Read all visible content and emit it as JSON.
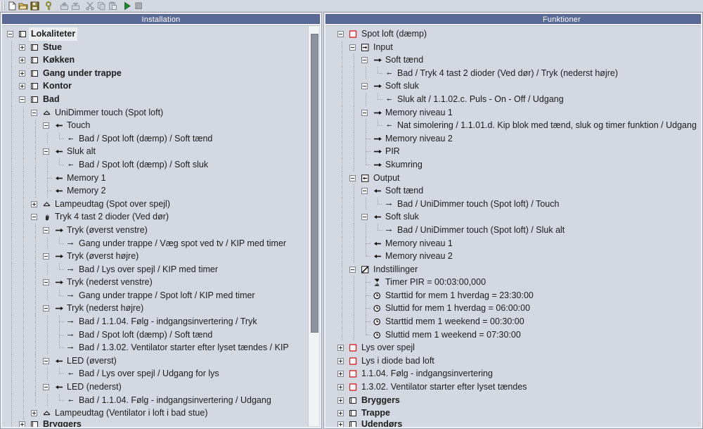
{
  "window": {
    "background_color": "#d4d8e0",
    "title_bar_color": "#5a6a96"
  },
  "toolbar": {
    "items": [
      {
        "name": "new-file-icon",
        "label": "Ny"
      },
      {
        "name": "open-folder-icon",
        "label": "Åbn"
      },
      {
        "name": "save-disk-icon",
        "label": "Gem"
      },
      {
        "name": "key-icon",
        "label": "Nøgle"
      },
      {
        "name": "upload-icon",
        "label": "Send til controller"
      },
      {
        "name": "download-icon",
        "label": "Hent fra controller"
      },
      {
        "name": "cut-scissors-icon",
        "label": "Klip"
      },
      {
        "name": "copy-icon",
        "label": "Kopier"
      },
      {
        "name": "paste-icon",
        "label": "Indsæt"
      },
      {
        "name": "run-play-icon",
        "label": "Start"
      },
      {
        "name": "stop-icon",
        "label": "Stop"
      }
    ]
  },
  "panels": {
    "left": {
      "title": "Installation",
      "scrollbar": {
        "visible": true,
        "thumb_top_pct": 2,
        "thumb_height_pct": 74
      }
    },
    "right": {
      "title": "Funktioner",
      "scrollbar": {
        "visible": false
      }
    }
  },
  "left_tree": [
    {
      "depth": 0,
      "exp": "minus",
      "icon": "folder-square",
      "label": "Lokaliteter",
      "bold": true,
      "selected": true
    },
    {
      "depth": 1,
      "exp": "plus",
      "icon": "folder-square",
      "label": "Stue",
      "bold": true
    },
    {
      "depth": 1,
      "exp": "plus",
      "icon": "folder-square",
      "label": "Køkken",
      "bold": true
    },
    {
      "depth": 1,
      "exp": "plus",
      "icon": "folder-square",
      "label": "Gang under trappe",
      "bold": true
    },
    {
      "depth": 1,
      "exp": "plus",
      "icon": "folder-square",
      "label": "Kontor",
      "bold": true
    },
    {
      "depth": 1,
      "exp": "minus",
      "icon": "folder-square",
      "label": "Bad",
      "bold": true
    },
    {
      "depth": 2,
      "exp": "minus",
      "icon": "lamp-outlet",
      "label": "UniDimmer touch (Spot loft)"
    },
    {
      "depth": 3,
      "exp": "minus",
      "icon": "arrow-left",
      "label": "Touch"
    },
    {
      "depth": 4,
      "exp": "leaf",
      "icon": "link-left",
      "label": "Bad / Spot loft (dæmp) / Soft tænd"
    },
    {
      "depth": 3,
      "exp": "minus",
      "icon": "arrow-left",
      "label": "Sluk alt"
    },
    {
      "depth": 4,
      "exp": "leaf",
      "icon": "link-left",
      "label": "Bad / Spot loft (dæmp) / Soft sluk"
    },
    {
      "depth": 3,
      "exp": "none",
      "icon": "arrow-left",
      "label": "Memory 1"
    },
    {
      "depth": 3,
      "exp": "none",
      "icon": "arrow-left",
      "label": "Memory 2"
    },
    {
      "depth": 2,
      "exp": "plus",
      "icon": "lamp-outlet",
      "label": "Lampeudtag (Spot over spejl)"
    },
    {
      "depth": 2,
      "exp": "minus",
      "icon": "hand-switch",
      "label": "Tryk 4 tast 2 dioder (Ved dør)"
    },
    {
      "depth": 3,
      "exp": "minus",
      "icon": "arrow-right",
      "label": "Tryk (øverst venstre)"
    },
    {
      "depth": 4,
      "exp": "leaf",
      "icon": "link-right",
      "label": "Gang under trappe / Væg spot ved tv / KIP med timer"
    },
    {
      "depth": 3,
      "exp": "minus",
      "icon": "arrow-right",
      "label": "Tryk (øverst højre)"
    },
    {
      "depth": 4,
      "exp": "leaf",
      "icon": "link-right",
      "label": "Bad / Lys over spejl / KIP med timer"
    },
    {
      "depth": 3,
      "exp": "minus",
      "icon": "arrow-right",
      "label": "Tryk (nederst venstre)"
    },
    {
      "depth": 4,
      "exp": "leaf",
      "icon": "link-right",
      "label": "Gang under trappe / Spot loft / KIP med timer"
    },
    {
      "depth": 3,
      "exp": "minus",
      "icon": "arrow-right",
      "label": "Tryk (nederst højre)"
    },
    {
      "depth": 4,
      "exp": "leaf-mid",
      "icon": "link-right",
      "label": "Bad / 1.1.04. Følg - indgangsinvertering / Tryk"
    },
    {
      "depth": 4,
      "exp": "leaf-mid",
      "icon": "link-right",
      "label": "Bad / Spot loft (dæmp) / Soft tænd"
    },
    {
      "depth": 4,
      "exp": "leaf",
      "icon": "link-right",
      "label": "Bad / 1.3.02. Ventilator starter efter lyset tændes / KIP"
    },
    {
      "depth": 3,
      "exp": "minus",
      "icon": "arrow-left",
      "label": "LED (øverst)"
    },
    {
      "depth": 4,
      "exp": "leaf",
      "icon": "link-left",
      "label": "Bad / Lys over spejl / Udgang for lys"
    },
    {
      "depth": 3,
      "exp": "minus",
      "icon": "arrow-left",
      "label": "LED (nederst)"
    },
    {
      "depth": 4,
      "exp": "leaf",
      "icon": "link-left",
      "label": "Bad / 1.1.04. Følg - indgangsinvertering / Udgang"
    },
    {
      "depth": 2,
      "exp": "plus",
      "icon": "lamp-outlet",
      "label": "Lampeudtag (Ventilator i loft i bad stue)"
    },
    {
      "depth": 1,
      "exp": "plus",
      "icon": "folder-square",
      "label": "Bryggers",
      "bold": true,
      "clipped": true
    }
  ],
  "right_tree": [
    {
      "depth": 0,
      "exp": "minus",
      "icon": "red-square",
      "label": "Spot loft (dæmp)"
    },
    {
      "depth": 1,
      "exp": "minus",
      "icon": "input-box",
      "label": "Input"
    },
    {
      "depth": 2,
      "exp": "minus",
      "icon": "arrow-right",
      "label": "Soft tænd"
    },
    {
      "depth": 3,
      "exp": "leaf",
      "icon": "link-left",
      "label": "Bad / Tryk 4 tast 2 dioder (Ved dør)  / Tryk (nederst højre)"
    },
    {
      "depth": 2,
      "exp": "minus",
      "icon": "arrow-right",
      "label": "Soft sluk"
    },
    {
      "depth": 3,
      "exp": "leaf",
      "icon": "link-left",
      "label": "Sluk alt / 1.1.02.c. Puls - On - Off / Udgang"
    },
    {
      "depth": 2,
      "exp": "minus",
      "icon": "arrow-right",
      "label": "Memory niveau 1"
    },
    {
      "depth": 3,
      "exp": "leaf",
      "icon": "link-left",
      "label": "Nat simolering / 1.1.01.d. Kip blok med tænd, sluk og timer funktion / Udgang"
    },
    {
      "depth": 2,
      "exp": "none",
      "icon": "arrow-right",
      "label": "Memory niveau 2"
    },
    {
      "depth": 2,
      "exp": "none",
      "icon": "arrow-right",
      "label": "PIR"
    },
    {
      "depth": 2,
      "exp": "none-last",
      "icon": "arrow-right",
      "label": "Skumring"
    },
    {
      "depth": 1,
      "exp": "minus",
      "icon": "output-box",
      "label": "Output"
    },
    {
      "depth": 2,
      "exp": "minus",
      "icon": "arrow-left",
      "label": "Soft tænd"
    },
    {
      "depth": 3,
      "exp": "leaf",
      "icon": "link-right",
      "label": "Bad / UniDimmer touch (Spot loft)  / Touch"
    },
    {
      "depth": 2,
      "exp": "minus",
      "icon": "arrow-left",
      "label": "Soft sluk"
    },
    {
      "depth": 3,
      "exp": "leaf",
      "icon": "link-right",
      "label": "Bad / UniDimmer touch (Spot loft)  / Sluk alt"
    },
    {
      "depth": 2,
      "exp": "none",
      "icon": "arrow-left",
      "label": "Memory niveau 1"
    },
    {
      "depth": 2,
      "exp": "none-last",
      "icon": "arrow-left",
      "label": "Memory niveau 2"
    },
    {
      "depth": 1,
      "exp": "minus",
      "icon": "settings-pencil",
      "label": "Indstillinger"
    },
    {
      "depth": 2,
      "exp": "none",
      "icon": "hourglass",
      "label": "Timer PIR = 00:03:00,000"
    },
    {
      "depth": 2,
      "exp": "none",
      "icon": "clock",
      "label": "Starttid for mem 1 hverdag = 23:30:00"
    },
    {
      "depth": 2,
      "exp": "none",
      "icon": "clock",
      "label": "Sluttid for mem 1 hverdag = 06:00:00"
    },
    {
      "depth": 2,
      "exp": "none",
      "icon": "clock",
      "label": "Starttid mem 1 weekend = 00:30:00"
    },
    {
      "depth": 2,
      "exp": "none-last",
      "icon": "clock",
      "label": "Sluttid mem 1 weekend = 07:30:00"
    },
    {
      "depth": 0,
      "exp": "plus",
      "icon": "red-square",
      "label": "Lys over spejl"
    },
    {
      "depth": 0,
      "exp": "plus",
      "icon": "red-square",
      "label": "Lys i diode bad loft"
    },
    {
      "depth": 0,
      "exp": "plus",
      "icon": "red-square",
      "label": "1.1.04. Følg - indgangsinvertering"
    },
    {
      "depth": 0,
      "exp": "plus",
      "icon": "red-square",
      "label": "1.3.02. Ventilator starter efter lyset tændes"
    },
    {
      "depth": -1,
      "exp": "plus",
      "icon": "folder-square",
      "label": "Bryggers",
      "bold": true
    },
    {
      "depth": -1,
      "exp": "plus",
      "icon": "folder-square",
      "label": "Trappe",
      "bold": true
    },
    {
      "depth": -1,
      "exp": "plus",
      "icon": "folder-square",
      "label": "Udendørs",
      "bold": true,
      "clipped": true
    }
  ]
}
